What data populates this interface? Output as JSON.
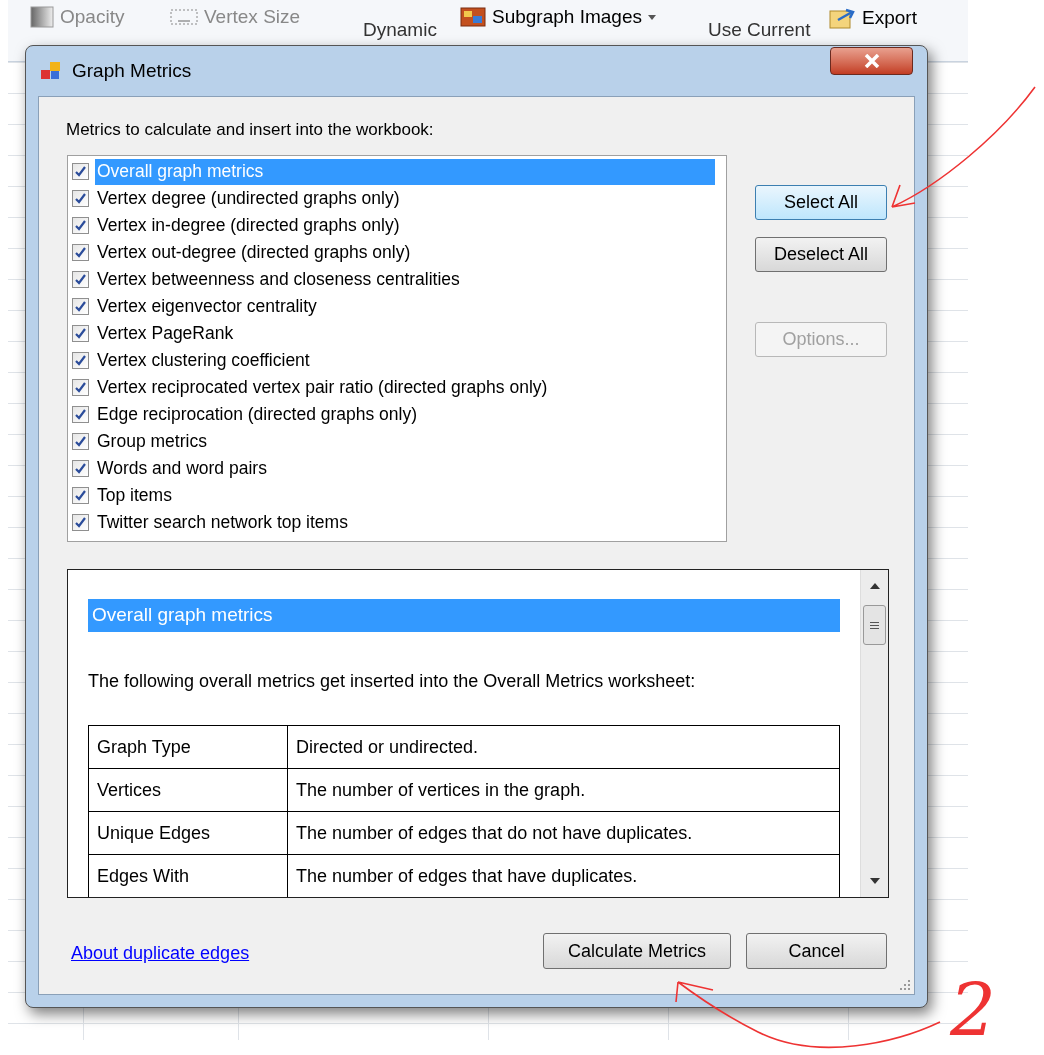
{
  "ribbon": {
    "items": [
      {
        "label": "Opacity",
        "kind": "opacity"
      },
      {
        "label": "Vertex Size",
        "kind": "size"
      },
      {
        "label": "Dynamic",
        "kind": "plain"
      },
      {
        "label": "Subgraph Images",
        "kind": "images"
      },
      {
        "label": "Use Current",
        "kind": "plain"
      },
      {
        "label": "Export",
        "kind": "export"
      }
    ]
  },
  "dialog": {
    "title": "Graph Metrics",
    "prompt": "Metrics to calculate and insert into the workbook:",
    "metrics": [
      {
        "label": "Overall graph metrics",
        "checked": true,
        "selected": true
      },
      {
        "label": "Vertex degree (undirected graphs only)",
        "checked": true,
        "selected": false
      },
      {
        "label": "Vertex in-degree (directed graphs only)",
        "checked": true,
        "selected": false
      },
      {
        "label": "Vertex out-degree (directed graphs only)",
        "checked": true,
        "selected": false
      },
      {
        "label": "Vertex betweenness and closeness centralities",
        "checked": true,
        "selected": false
      },
      {
        "label": "Vertex eigenvector centrality",
        "checked": true,
        "selected": false
      },
      {
        "label": "Vertex PageRank",
        "checked": true,
        "selected": false
      },
      {
        "label": "Vertex clustering coefficient",
        "checked": true,
        "selected": false
      },
      {
        "label": "Vertex reciprocated vertex pair ratio (directed graphs only)",
        "checked": true,
        "selected": false
      },
      {
        "label": "Edge reciprocation (directed graphs only)",
        "checked": true,
        "selected": false
      },
      {
        "label": "Group metrics",
        "checked": true,
        "selected": false
      },
      {
        "label": "Words and word pairs",
        "checked": true,
        "selected": false
      },
      {
        "label": "Top items",
        "checked": true,
        "selected": false
      },
      {
        "label": "Twitter search network top items",
        "checked": true,
        "selected": false
      }
    ],
    "side_buttons": [
      {
        "label": "Select All",
        "disabled": false
      },
      {
        "label": "Deselect All",
        "disabled": false
      },
      {
        "label": "Options...",
        "disabled": true
      }
    ],
    "help": {
      "heading": "Overall graph metrics",
      "intro": "The following overall metrics get inserted into the Overall Metrics worksheet:",
      "table": [
        [
          "Graph Type",
          "Directed or undirected."
        ],
        [
          "Vertices",
          "The number of vertices in the graph."
        ],
        [
          "Unique Edges",
          "The number of edges that do not have duplicates."
        ],
        [
          "Edges With",
          "The number of edges that have duplicates."
        ]
      ]
    },
    "link": "About duplicate edges",
    "buttons": [
      "Calculate Metrics",
      "Cancel"
    ]
  },
  "annotation": {
    "step_number": "2"
  }
}
